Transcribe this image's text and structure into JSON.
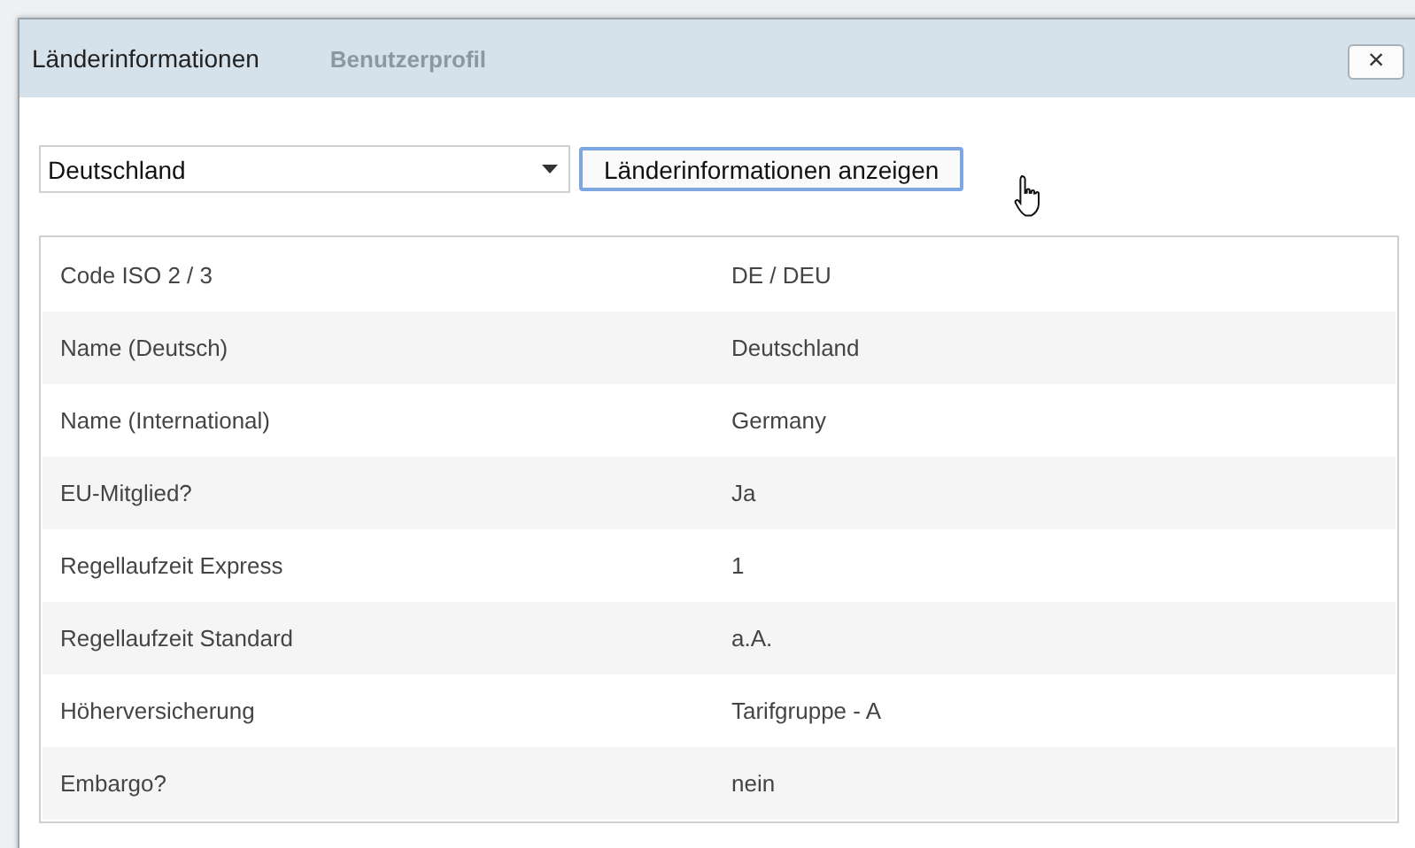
{
  "background": {
    "nav_item": "Benutzerprofil"
  },
  "window": {
    "title": "Länderinformationen",
    "close": "×"
  },
  "country_select": {
    "value": "Deutschland"
  },
  "show_button": {
    "label": "Länderinformationen anzeigen"
  },
  "table": {
    "rows": [
      {
        "label": "Code ISO 2 / 3",
        "value": "DE / DEU"
      },
      {
        "label": "Name (Deutsch)",
        "value": "Deutschland"
      },
      {
        "label": "Name (International)",
        "value": "Germany"
      },
      {
        "label": "EU-Mitglied?",
        "value": "Ja"
      },
      {
        "label": "Regellaufzeit Express",
        "value": "1"
      },
      {
        "label": "Regellaufzeit Standard",
        "value": "a.A."
      },
      {
        "label": "Höherversicherung",
        "value": "Tarifgruppe - A"
      },
      {
        "label": "Embargo?",
        "value": "nein"
      }
    ]
  }
}
